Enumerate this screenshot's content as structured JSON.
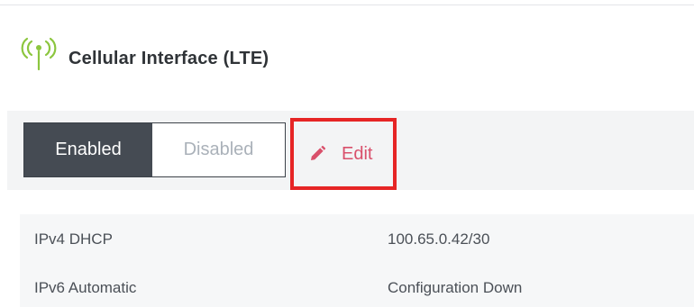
{
  "header": {
    "icon": "cellular-antenna-icon",
    "title": "Cellular Interface (LTE)",
    "icon_color": "#8cc63f"
  },
  "toolbar": {
    "enabled_label": "Enabled",
    "disabled_label": "Disabled",
    "selected": "Enabled",
    "edit_label": "Edit",
    "edit_icon": "pencil-icon",
    "edit_color": "#d9506b",
    "highlight_color": "#e62525"
  },
  "details": {
    "rows": [
      {
        "label": "IPv4 DHCP",
        "value": "100.65.0.42/30"
      },
      {
        "label": "IPv6 Automatic",
        "value": "Configuration Down"
      }
    ]
  }
}
